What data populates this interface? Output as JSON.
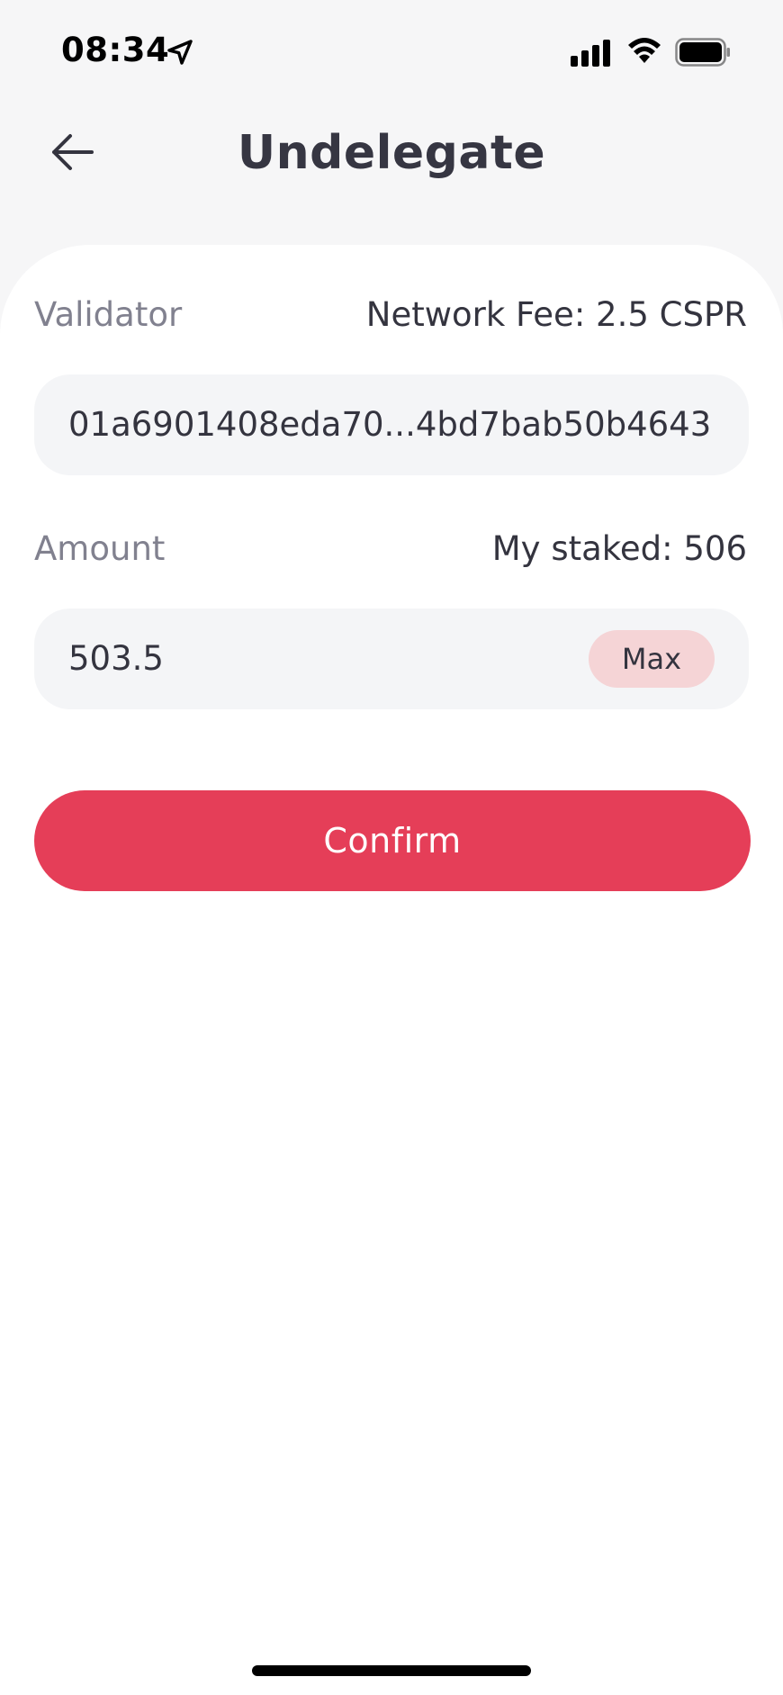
{
  "status_bar": {
    "time": "08:34",
    "icons": [
      "location-arrow-icon",
      "cellular-signal-icon",
      "wifi-icon",
      "battery-icon"
    ]
  },
  "header": {
    "title": "Undelegate",
    "back_icon": "arrow-left-icon"
  },
  "form": {
    "validator_label": "Validator",
    "network_fee": "Network Fee: 2.5 CSPR",
    "validator_value": "01a6901408eda70...4bd7bab50b4643",
    "amount_label": "Amount",
    "my_staked": "My staked: 506",
    "amount_value": "503.5",
    "max_label": "Max",
    "confirm_label": "Confirm"
  },
  "colors": {
    "accent": "#e53e58",
    "max_bg": "#f5d4d6",
    "field_bg": "#f4f5f7",
    "page_bg": "#f6f6f7",
    "muted_label": "#81818f",
    "text": "#34343f"
  }
}
